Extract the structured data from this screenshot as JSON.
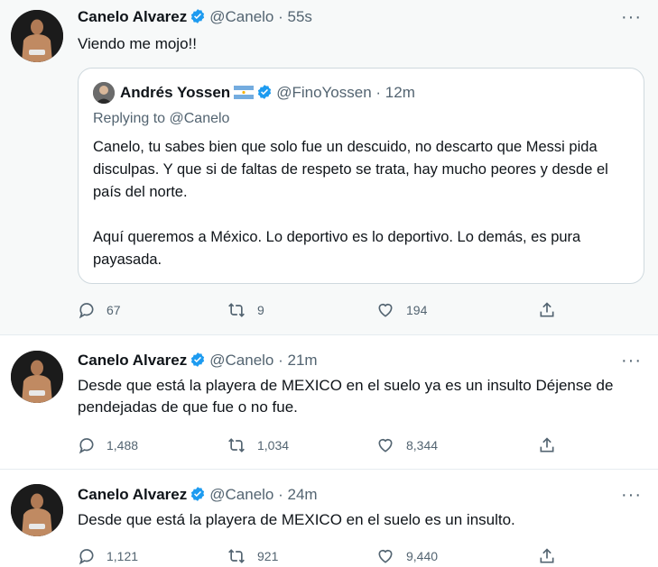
{
  "colors": {
    "verified": "#1d9bf0",
    "secondary_text": "#536471",
    "primary_text": "#0f1419",
    "first_tweet_bg": "#f7f9f9"
  },
  "tweets": [
    {
      "name": "Canelo Alvarez",
      "handle": "@Canelo",
      "time": "· 55s",
      "text": "Viendo me mojo!!",
      "quote": {
        "name": "Andrés Yossen",
        "flag": "argentina-flag-icon",
        "handle": "@FinoYossen",
        "time": "· 12m",
        "replying_prefix": "Replying to",
        "replying_handle": "@Canelo",
        "paragraph1": "Canelo, tu sabes bien que solo fue un descuido, no descarto que Messi pida disculpas. Y que si de faltas de respeto se trata, hay mucho peores y desde el país del norte.",
        "paragraph2": "Aquí queremos a México. Lo deportivo es lo deportivo. Lo demás, es pura payasada."
      },
      "replies": "67",
      "retweets": "9",
      "likes": "194"
    },
    {
      "name": "Canelo Alvarez",
      "handle": "@Canelo",
      "time": "· 21m",
      "text": "Desde que está la playera de MEXICO en el suelo ya es un insulto Déjense de pendejadas de que fue o no fue.",
      "replies": "1,488",
      "retweets": "1,034",
      "likes": "8,344"
    },
    {
      "name": "Canelo Alvarez",
      "handle": "@Canelo",
      "time": "· 24m",
      "text": "Desde que está la playera de MEXICO en el suelo es un insulto.",
      "replies": "1,121",
      "retweets": "921",
      "likes": "9,440"
    }
  ]
}
